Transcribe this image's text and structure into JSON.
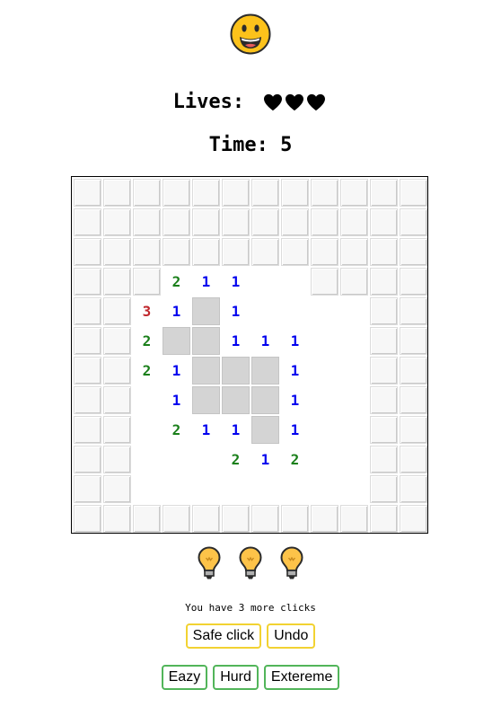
{
  "header": {
    "lives_label": "Lives:",
    "lives_count": 3,
    "time_label": "Time:",
    "time_value": "5"
  },
  "board": {
    "rows": 12,
    "cols": 12,
    "revealed_region": [
      [
        3,
        3,
        10,
        7
      ],
      [
        4,
        2,
        10,
        2
      ],
      [
        4,
        6,
        10,
        9
      ]
    ],
    "number_cells": [
      {
        "r": 3,
        "c": 3,
        "n": "2"
      },
      {
        "r": 3,
        "c": 4,
        "n": "1"
      },
      {
        "r": 3,
        "c": 5,
        "n": "1"
      },
      {
        "r": 4,
        "c": 2,
        "n": "3"
      },
      {
        "r": 4,
        "c": 3,
        "n": "1"
      },
      {
        "r": 4,
        "c": 5,
        "n": "1"
      },
      {
        "r": 5,
        "c": 2,
        "n": "2"
      },
      {
        "r": 5,
        "c": 5,
        "n": "1"
      },
      {
        "r": 5,
        "c": 6,
        "n": "1"
      },
      {
        "r": 5,
        "c": 7,
        "n": "1"
      },
      {
        "r": 6,
        "c": 2,
        "n": "2"
      },
      {
        "r": 6,
        "c": 3,
        "n": "1"
      },
      {
        "r": 6,
        "c": 7,
        "n": "1"
      },
      {
        "r": 7,
        "c": 3,
        "n": "1"
      },
      {
        "r": 7,
        "c": 7,
        "n": "1"
      },
      {
        "r": 8,
        "c": 3,
        "n": "2"
      },
      {
        "r": 8,
        "c": 4,
        "n": "1"
      },
      {
        "r": 8,
        "c": 5,
        "n": "1"
      },
      {
        "r": 8,
        "c": 7,
        "n": "1"
      },
      {
        "r": 9,
        "c": 5,
        "n": "2"
      },
      {
        "r": 9,
        "c": 6,
        "n": "1"
      },
      {
        "r": 9,
        "c": 7,
        "n": "2"
      }
    ],
    "gray_cells": [
      {
        "r": 4,
        "c": 4
      },
      {
        "r": 5,
        "c": 3
      },
      {
        "r": 5,
        "c": 4
      },
      {
        "r": 6,
        "c": 4
      },
      {
        "r": 6,
        "c": 5
      },
      {
        "r": 6,
        "c": 6
      },
      {
        "r": 7,
        "c": 4
      },
      {
        "r": 7,
        "c": 5
      },
      {
        "r": 7,
        "c": 6
      },
      {
        "r": 8,
        "c": 6
      }
    ],
    "number_colors": {
      "1": "#0000ee",
      "2": "#1a7f1a",
      "3": "#c0282d"
    }
  },
  "hints": {
    "count": 3,
    "icon": "lightbulb-icon"
  },
  "clicks_text": "You have 3 more clicks",
  "buttons": {
    "safe_click": "Safe click",
    "undo": "Undo",
    "eazy": "Eazy",
    "hurd": "Hurd",
    "extereme": "Extereme"
  },
  "colors": {
    "yellow_border": "#f2d232",
    "green_border": "#52b55a",
    "smiley_face": "#fcc21b"
  }
}
